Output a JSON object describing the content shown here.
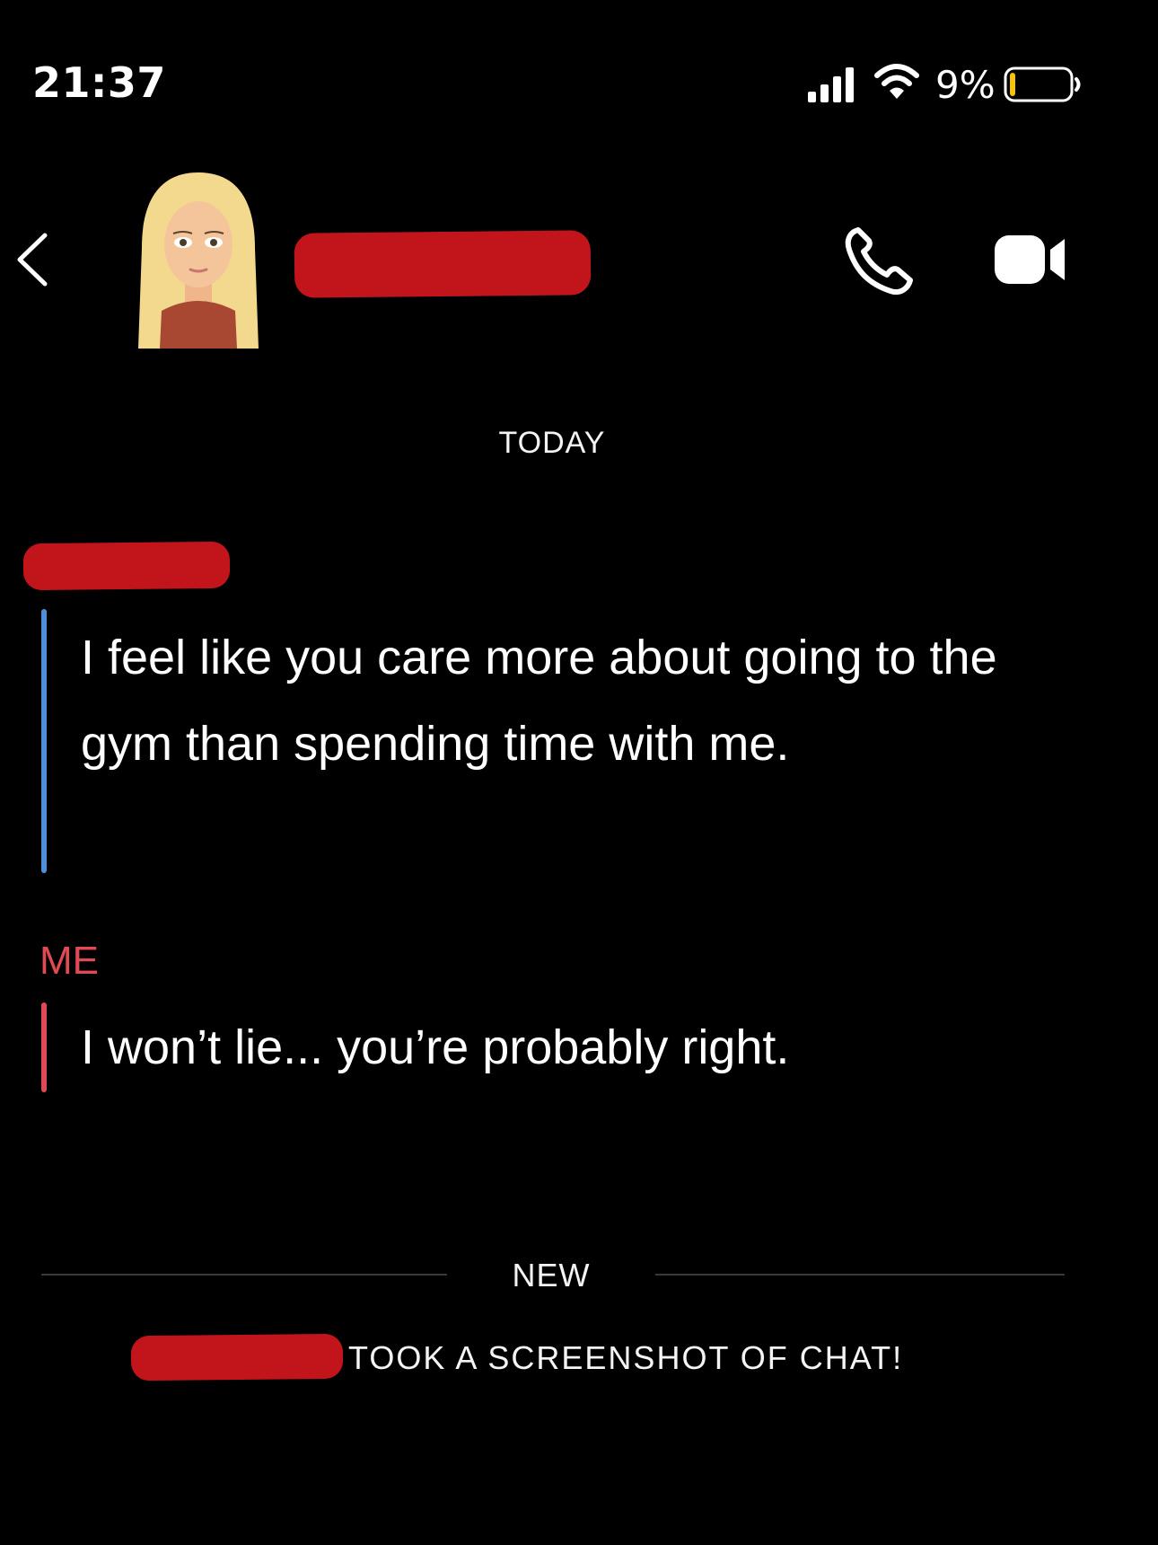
{
  "status_bar": {
    "time": "21:37",
    "battery_percent": "9%",
    "battery_level": 0.09,
    "icons": [
      "cellular-signal-icon",
      "wifi-icon",
      "battery-icon"
    ]
  },
  "header": {
    "back_icon": "chevron-left-icon",
    "avatar": "bitmoji-avatar",
    "name_redacted": true,
    "call_icon": "phone-icon",
    "video_icon": "video-camera-icon"
  },
  "chat": {
    "day_label": "TODAY",
    "messages": [
      {
        "sender_redacted": true,
        "text": "I feel like you care more about going to the gym than spending time with me.",
        "accent_color": "#4f8fd9"
      },
      {
        "sender_label": "ME",
        "text": "I won’t lie... you’re probably right.",
        "accent_color": "#e04a55"
      }
    ],
    "new_label": "NEW",
    "screenshot_notice": "TOOK A SCREENSHOT OF CHAT!"
  },
  "colors": {
    "background": "#000000",
    "redaction": "#c2151b",
    "me_accent": "#e04a55",
    "friend_accent": "#4f8fd9"
  }
}
